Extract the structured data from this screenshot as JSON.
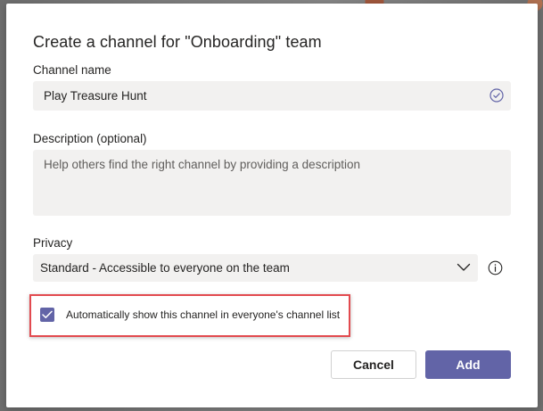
{
  "dialog": {
    "title": "Create a channel for \"Onboarding\" team"
  },
  "channel_name": {
    "label": "Channel name",
    "value": "Play Treasure Hunt",
    "status_icon": "check-circle-icon"
  },
  "description": {
    "label": "Description (optional)",
    "placeholder": "Help others find the right channel by providing a description",
    "value": ""
  },
  "privacy": {
    "label": "Privacy",
    "selected": "Standard - Accessible to everyone on the team",
    "icon": "chevron-down-icon",
    "info_icon": "info-icon"
  },
  "auto_show": {
    "checked": true,
    "label": "Automatically show this channel in everyone's channel list",
    "highlight_color": "#e24a4f"
  },
  "buttons": {
    "cancel_label": "Cancel",
    "add_label": "Add"
  },
  "colors": {
    "accent": "#6264a7",
    "field_bg": "#f2f1f0",
    "text": "#252423"
  }
}
